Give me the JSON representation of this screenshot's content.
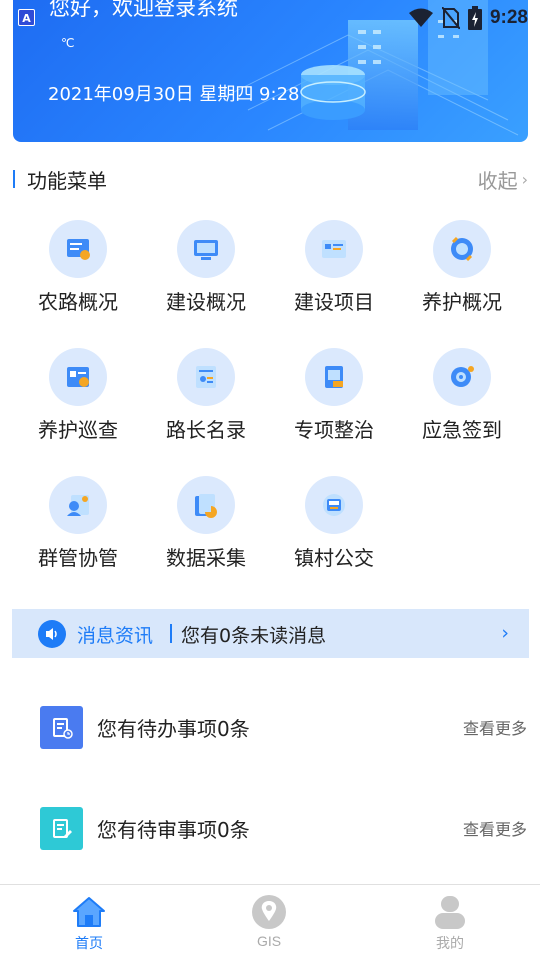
{
  "status_bar": {
    "time": "9:28",
    "app_icon_letter": "A"
  },
  "banner": {
    "greeting": "您好，欢迎登录系统",
    "unit": "℃",
    "datetime": "2021年09月30日 星期四 9:28"
  },
  "menu_section": {
    "title": "功能菜单",
    "collapse_label": "收起"
  },
  "menu": {
    "items": [
      {
        "label": "农路概况",
        "icon": "rural-road-icon"
      },
      {
        "label": "建设概况",
        "icon": "construction-overview-icon"
      },
      {
        "label": "建设项目",
        "icon": "construction-project-icon"
      },
      {
        "label": "养护概况",
        "icon": "maintenance-overview-icon"
      },
      {
        "label": "养护巡查",
        "icon": "maintenance-patrol-icon"
      },
      {
        "label": "路长名录",
        "icon": "road-chief-list-icon"
      },
      {
        "label": "专项整治",
        "icon": "special-rectification-icon"
      },
      {
        "label": "应急签到",
        "icon": "emergency-checkin-icon"
      },
      {
        "label": "群管协管",
        "icon": "group-management-icon"
      },
      {
        "label": "数据采集",
        "icon": "data-collection-icon"
      },
      {
        "label": "镇村公交",
        "icon": "village-bus-icon"
      }
    ]
  },
  "messages": {
    "label": "消息资讯",
    "text": "您有0条未读消息"
  },
  "todos": [
    {
      "text": "您有待办事项0条",
      "more": "查看更多",
      "color": "#4a7bf0"
    },
    {
      "text": "您有待审事项0条",
      "more": "查看更多",
      "color": "#2ec9d6"
    }
  ],
  "bottom_nav": {
    "items": [
      {
        "label": "首页",
        "active": true
      },
      {
        "label": "GIS",
        "active": false
      },
      {
        "label": "我的",
        "active": false
      }
    ],
    "active_color": "#1e7cf7",
    "inactive_color": "#aaaaaa"
  }
}
